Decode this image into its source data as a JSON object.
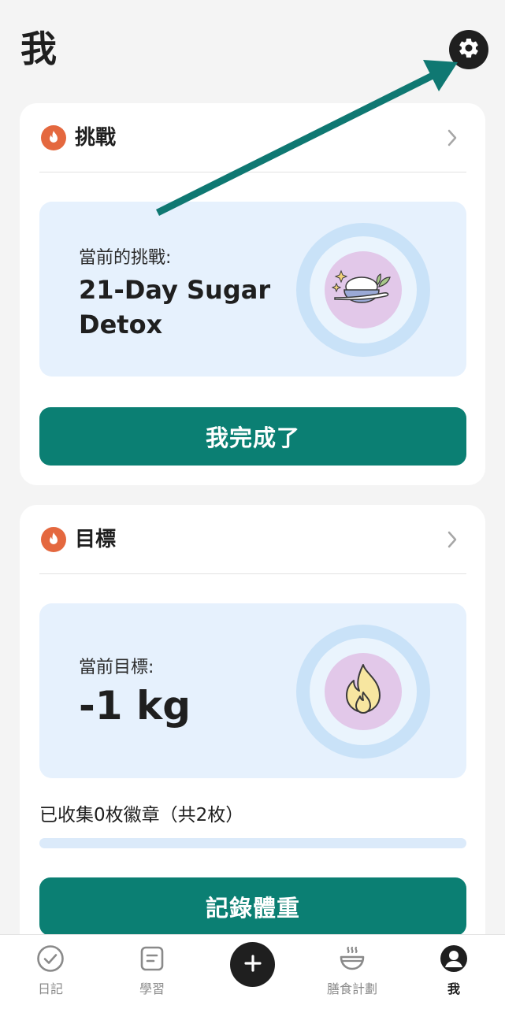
{
  "page": {
    "title": "我"
  },
  "colors": {
    "accent": "#0b7f73",
    "flame": "#e4683f",
    "annotation_arrow": "#0f7872"
  },
  "challenge": {
    "title": "挑戰",
    "current_label": "當前的挑戰:",
    "name_line1": "21-Day Sugar",
    "name_line2": "Detox",
    "button": "我完成了",
    "illustration_icon": "rice-bowl-icon"
  },
  "goal": {
    "title": "目標",
    "current_label": "當前目標:",
    "value": "-1 kg",
    "badges_text": "已收集0枚徽章（共2枚）",
    "badges_collected": 0,
    "badges_total": 2,
    "button": "記錄體重",
    "illustration_icon": "flame-icon"
  },
  "tabbar": {
    "items": [
      {
        "label": "日記",
        "icon": "check-circle-icon",
        "active": false
      },
      {
        "label": "學習",
        "icon": "document-icon",
        "active": false
      },
      {
        "label": "",
        "icon": "plus-icon",
        "active": false
      },
      {
        "label": "膳食計劃",
        "icon": "bowl-icon",
        "active": false
      },
      {
        "label": "我",
        "icon": "profile-icon",
        "active": true
      }
    ]
  }
}
